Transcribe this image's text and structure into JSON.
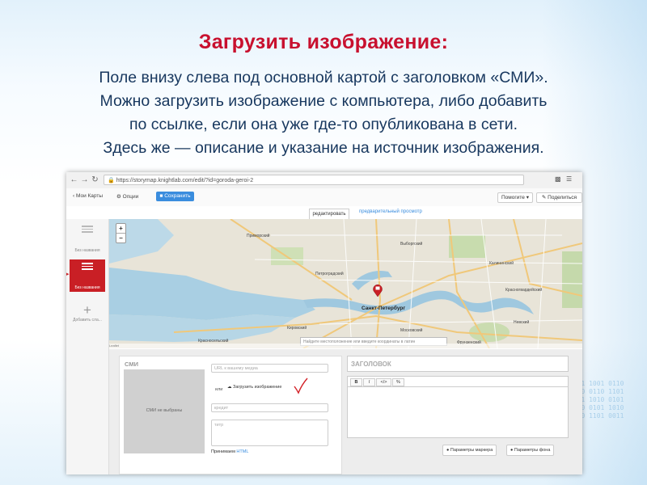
{
  "slide": {
    "title": "Загрузить изображение:",
    "lines": [
      "Поле внизу слева под основной картой  с заголовком «СМИ».",
      "Можно загрузить изображение с компьютера, либо добавить",
      "по ссылке, если она уже где-то опубликована в сети.",
      "Здесь же — описание и указание на источник изображения."
    ],
    "title_color": "#c8102e",
    "text_color": "#17375e"
  },
  "browser": {
    "url": "https://storymap.knightlab.com/edit/?id=goroda-geroi-2",
    "back_icon": "arrow-left-icon",
    "forward_icon": "arrow-right-icon",
    "reload_icon": "reload-icon"
  },
  "toolbar": {
    "my_maps": "Мои Карты",
    "options": "Опции",
    "save": "Сохранить",
    "help": "Помогите",
    "share": "Поделиться",
    "accent": "#3a8dde"
  },
  "mode_tabs": {
    "edit": "редактировать",
    "preview": "предварительный просмотр"
  },
  "sidebar": {
    "items": [
      {
        "label": "Без названия"
      },
      {
        "label": "Без названия"
      }
    ],
    "add_label": "Добавить сла..."
  },
  "map": {
    "zoom_in": "+",
    "zoom_out": "−",
    "city": "Санкт-Петербург",
    "search_placeholder": "Найдите местоположение или введите координаты в латин",
    "attribution": "Leaflet",
    "labels": [
      "Приморский",
      "Выборгский",
      "Калининский",
      "Красногвардейский",
      "Петроградский",
      "Невский",
      "Кировский",
      "Московский",
      "Фрунзенский",
      "Красносельский"
    ]
  },
  "media": {
    "title": "СМИ",
    "preview_text": "СМИ не выбраны",
    "url_placeholder": "URL к вашему медиа",
    "or_label": "или",
    "upload_label": "Загрузить изображение",
    "credit_placeholder": "кредит",
    "caption_placeholder": "титр",
    "accepts_prefix": "Принимаем",
    "accepts_link": "HTML"
  },
  "text_panel": {
    "heading_placeholder": "ЗАГОЛОВОК",
    "rte_buttons": [
      "B",
      "I",
      "</>",
      "%"
    ],
    "marker_options": "Параметры маркера",
    "background_options": "Параметры фона"
  }
}
